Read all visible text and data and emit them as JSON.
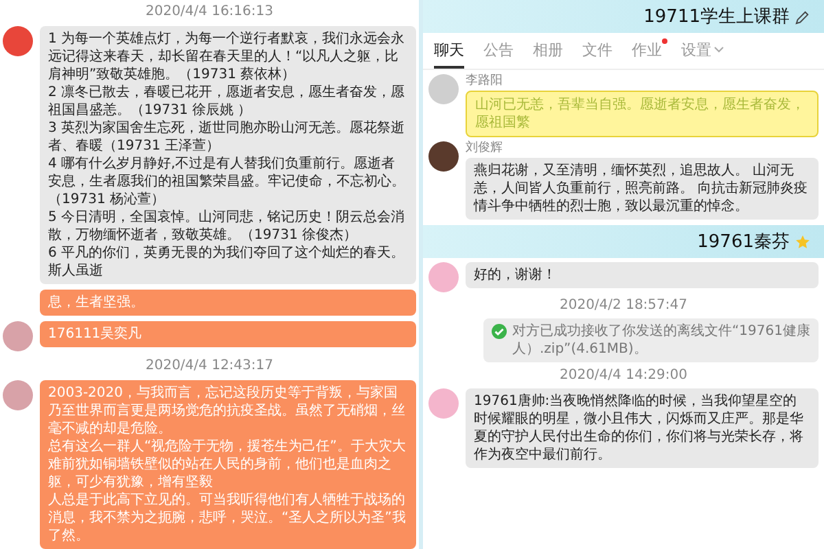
{
  "left": {
    "items": [
      {
        "kind": "time",
        "text": "2020/4/4 16:16:13"
      },
      {
        "kind": "message",
        "paragraphs": [
          "1  为每一个英雄点灯，为每一个逆行者默哀，我们永远会永远记得这来春天，却长留在春天里的人！“以凡人之躯，比肩神明”致敬英雄胞。（19731 蔡依林）",
          "2  凛冬已散去，春暖已花开，愿逝者安息，愿生者奋发，愿祖国昌盛恙。（19731 徐辰姚 ）",
          "3  英烈为家国舍生忘死，逝世同胞亦盼山河无恙。愿花祭逝者、春暖（19731 王泽萱）",
          "4  哪有什么岁月静好,不过是有人替我们负重前行。愿逝者安息，生者愿我们的祖国繁荣昌盛。牢记使命，不忘初心。（19731 杨沁萱）",
          "5  今日清明，全国哀悼。山河同悲，铭记历史！阴云总会消散，万物缅怀逝者，致敬英雄。（19731 徐俊杰）",
          "6  平凡的你们，英勇无畏的为我们夺回了这个灿烂的春天。斯人虽逝"
        ]
      },
      {
        "kind": "message",
        "paragraphs": [
          "息，生者坚强。"
        ]
      },
      {
        "kind": "message",
        "paragraphs": [
          "176111吴奕凡"
        ]
      },
      {
        "kind": "time",
        "text": "2020/4/4 12:43:17"
      },
      {
        "kind": "message",
        "paragraphs": [
          "2003-2020，与我而言，忘记这段历史等于背叛，与家国乃至世界而言更是两场觉危的抗疫圣战。虽然了无硝烟，丝毫不减的却是危险。",
          "总有这么一群人“视危险于无物，援苍生为己任”。于大灾大难前犹如铜墙铁壁似的站在人民的身前，他们也是血肉之躯，可少有犹豫，增有坚毅",
          "人总是于此高下立见的。可当我听得他们有人牺牲于战场的消息，我不禁为之扼腕，悲呼，哭泣。“圣人之所以为圣”我了然。"
        ]
      }
    ]
  },
  "right": {
    "panels": [
      {
        "title": "19711学生上课群",
        "starred": false,
        "tabs": [
          {
            "label": "聊天",
            "selected": true,
            "badge": false,
            "menu": false
          },
          {
            "label": "公告",
            "selected": false,
            "badge": false,
            "menu": false
          },
          {
            "label": "相册",
            "selected": false,
            "badge": false,
            "menu": false
          },
          {
            "label": "文件",
            "selected": false,
            "badge": false,
            "menu": false
          },
          {
            "label": "作业",
            "selected": false,
            "badge": true,
            "menu": false
          },
          {
            "label": "设置",
            "selected": false,
            "badge": false,
            "menu": true
          }
        ],
        "items": [
          {
            "kind": "message",
            "sender": "李路阳",
            "paragraphs": [
              "山河已无恙，吾辈当自强。愿逝者安息，愿生者奋发，愿祖国繁"
            ]
          },
          {
            "kind": "message",
            "sender": "刘俊辉",
            "paragraphs": [
              "燕归花谢，又至清明，缅怀英烈，追思故人。 山河无恙，人间皆人负重前行，照亮前路。 向抗击新冠肺炎疫情斗争中牺牲的烈士胞，致以最沉重的悼念。"
            ]
          }
        ]
      },
      {
        "title": "19761秦芬",
        "starred": true,
        "items": [
          {
            "kind": "message",
            "paragraphs": [
              "好的，谢谢！"
            ]
          },
          {
            "kind": "time",
            "text": "2020/4/2 18:57:47"
          },
          {
            "kind": "notice",
            "text": "对方已成功接收了你发送的离线文件“19761健康人）.zip”(4.61MB)。"
          },
          {
            "kind": "time",
            "text": "2020/4/4 14:29:00"
          },
          {
            "kind": "message",
            "paragraphs": [
              "19761唐帅:当夜晚悄然降临的时候，当我仰望星空的时候耀眼的明星，微小且伟大，闪烁而又庄严。那是华夏的守护人民付出生命的你们，你们将与光荣长存，将作为夜空中最们前行。"
            ]
          }
        ]
      }
    ]
  }
}
